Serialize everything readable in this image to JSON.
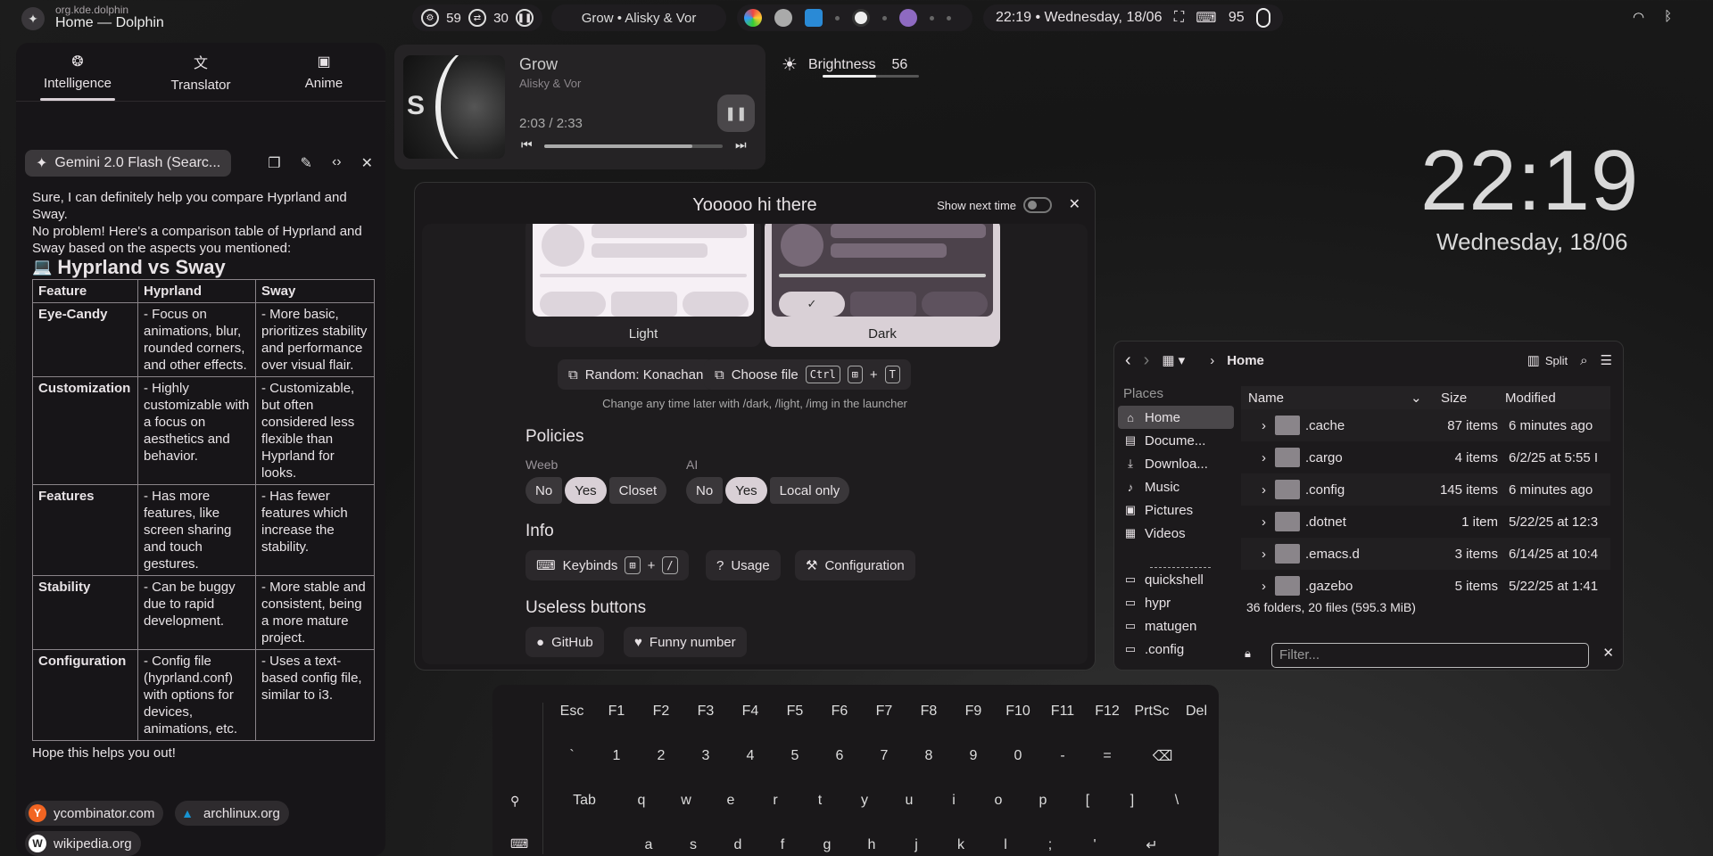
{
  "topbar": {
    "window_class": "org.kde.dolphin",
    "window_title": "Home — Dolphin",
    "cpu": "59",
    "swap": "30",
    "now_playing": "Grow • Alisky & Vor",
    "clock": "22:19 • Wednesday, 18/06",
    "battery": "95"
  },
  "sidebar": {
    "tabs": [
      {
        "label": "Intelligence",
        "icon": "brain-icon"
      },
      {
        "label": "Translator",
        "icon": "translate-icon"
      },
      {
        "label": "Anime",
        "icon": "bookmark-icon"
      }
    ],
    "model": "Gemini 2.0 Flash (Searc...",
    "chat": {
      "intro1": "Sure, I can definitely help you compare Hyprland and Sway.",
      "intro2": "No problem! Here's a comparison table of Hyprland and Sway based on the aspects you mentioned:",
      "heading": "Hyprland vs Sway",
      "heading_emoji": "💻",
      "table_headers": [
        "Feature",
        "Hyprland",
        "Sway"
      ],
      "rows": [
        {
          "feature": "Eye-Candy",
          "hypr": "- Focus on animations, blur, rounded corners, and other effects.",
          "sway": "- More basic, prioritizes stability and performance over visual flair."
        },
        {
          "feature": "Customization",
          "hypr": "- Highly customizable with a focus on aesthetics and behavior.",
          "sway": "- Customizable, but often considered less flexible than Hyprland for looks."
        },
        {
          "feature": "Features",
          "hypr": "- Has more features, like screen sharing and touch gestures.",
          "sway": "- Has fewer features which increase the stability."
        },
        {
          "feature": "Stability",
          "hypr": "- Can be buggy due to rapid development.",
          "sway": "- More stable and consistent, being a more mature project."
        },
        {
          "feature": "Configuration",
          "hypr": "- Config file (hyprland.conf) with options for devices, animations, etc.",
          "sway": "- Uses a text-based config file, similar to i3."
        }
      ],
      "outro": "Hope this helps you out!"
    },
    "sources": [
      {
        "label": "ycombinator.com",
        "icon": "Y",
        "color": "#f26522"
      },
      {
        "label": "archlinux.org",
        "icon": "▲",
        "color": "#1793d1"
      },
      {
        "label": "wikipedia.org",
        "icon": "W",
        "color": "#888888"
      }
    ]
  },
  "player": {
    "title": "Grow",
    "artist": "Alisky & Vor",
    "time": "2:03 / 2:33",
    "progress": 0.83,
    "cover_letter": "S"
  },
  "brightness": {
    "label": "Brightness",
    "value": "56",
    "level": 0.56
  },
  "dialog": {
    "title": "Yooooo hi there",
    "show_next": "Show next time",
    "theme_light": "Light",
    "theme_dark": "Dark",
    "random_btn": "Random: Konachan",
    "choose_btn": "Choose file",
    "kbd_ctrl": "Ctrl",
    "kbd_t": "T",
    "plus": "+",
    "hint": "Change any time later with /dark, /light, /img in the launcher",
    "policies": "Policies",
    "weeb_label": "Weeb",
    "weeb_options": [
      "No",
      "Yes",
      "Closet"
    ],
    "ai_label": "AI",
    "ai_options": [
      "No",
      "Yes",
      "Local only"
    ],
    "info": "Info",
    "keybinds": "Keybinds",
    "kbd_slash": "/",
    "usage": "Usage",
    "configuration": "Configuration",
    "useless": "Useless buttons",
    "github": "GitHub",
    "funny": "Funny number"
  },
  "clock": {
    "time": "22:19",
    "date": "Wednesday, 18/06"
  },
  "dolphin": {
    "location": "Home",
    "split": "Split",
    "places_title": "Places",
    "places": [
      {
        "label": "Home",
        "icon": "⌂"
      },
      {
        "label": "Docume...",
        "icon": "▤"
      },
      {
        "label": "Downloa...",
        "icon": "⤓"
      },
      {
        "label": "Music",
        "icon": "♪"
      },
      {
        "label": "Pictures",
        "icon": "▣"
      },
      {
        "label": "Videos",
        "icon": "▦"
      },
      {
        "label": "quickshell",
        "icon": "▭"
      },
      {
        "label": "hypr",
        "icon": "▭"
      },
      {
        "label": "matugen",
        "icon": "▭"
      },
      {
        "label": ".config",
        "icon": "▭"
      }
    ],
    "columns": [
      "Name",
      "Size",
      "Modified"
    ],
    "files": [
      {
        "name": ".cache",
        "size": "87 items",
        "modified": "6 minutes ago"
      },
      {
        "name": ".cargo",
        "size": "4 items",
        "modified": "6/2/25 at 5:55 I"
      },
      {
        "name": ".config",
        "size": "145 items",
        "modified": "6 minutes ago"
      },
      {
        "name": ".dotnet",
        "size": "1 item",
        "modified": "5/22/25 at 12:3"
      },
      {
        "name": ".emacs.d",
        "size": "3 items",
        "modified": "6/14/25 at 10:4"
      },
      {
        "name": ".gazebo",
        "size": "5 items",
        "modified": "5/22/25 at 1:41"
      }
    ],
    "status": "36 folders, 20 files (595.3 MiB)",
    "filter_placeholder": "Filter..."
  },
  "keyboard": {
    "row1": [
      "Esc",
      "F1",
      "F2",
      "F3",
      "F4",
      "F5",
      "F6",
      "F7",
      "F8",
      "F9",
      "F10",
      "F11",
      "F12",
      "PrtSc",
      "Del"
    ],
    "row2": [
      "`",
      "1",
      "2",
      "3",
      "4",
      "5",
      "6",
      "7",
      "8",
      "9",
      "0",
      "-",
      "=",
      "⌫"
    ],
    "row3": [
      "Tab",
      "q",
      "w",
      "e",
      "r",
      "t",
      "y",
      "u",
      "i",
      "o",
      "p",
      "[",
      "]",
      "\\"
    ],
    "row4": [
      "a",
      "s",
      "d",
      "f",
      "g",
      "h",
      "j",
      "k",
      "l",
      ";",
      "'",
      "↵"
    ]
  }
}
